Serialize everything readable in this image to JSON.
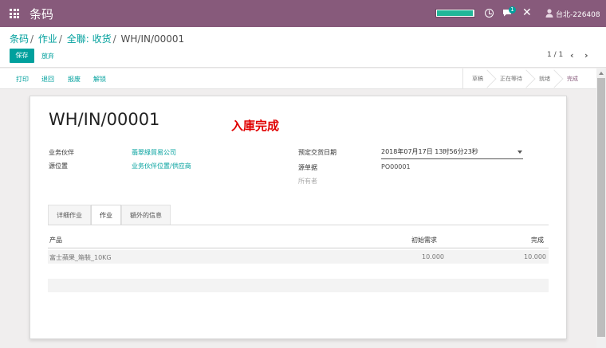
{
  "navbar": {
    "app_title": "条码",
    "user_name": "台北-226408",
    "badge_count": "1",
    "progress_percent": 98
  },
  "breadcrumb": {
    "items": [
      "条码",
      "作业",
      "全聯: 收货"
    ],
    "current": "WH/IN/00001"
  },
  "buttons": {
    "save": "保存",
    "discard": "放弃"
  },
  "pager": {
    "value": "1 / 1"
  },
  "actions": [
    "打印",
    "退回",
    "报废",
    "解锁"
  ],
  "stages": [
    {
      "label": "草稿",
      "active": false
    },
    {
      "label": "正在等待",
      "active": false
    },
    {
      "label": "就绪",
      "active": false
    },
    {
      "label": "完成",
      "active": true
    }
  ],
  "record": {
    "title": "WH/IN/00001",
    "stamp": "入庫完成",
    "partner_label": "业务伙伴",
    "partner_value": "翡翠綠貿易公司",
    "source_location_label": "源位置",
    "source_location_value": "业务伙伴位置/供应商",
    "scheduled_date_label": "预定交货日期",
    "scheduled_date_value": "2018年07月17日 13时56分23秒",
    "source_doc_label": "源单据",
    "source_doc_value": "PO00001",
    "owner_label": "所有者"
  },
  "tabs": [
    {
      "label": "详细作业",
      "active": false
    },
    {
      "label": "作业",
      "active": true
    },
    {
      "label": "額外的信息",
      "active": false
    }
  ],
  "table": {
    "headers": {
      "product": "产品",
      "initial_demand": "初始需求",
      "done": "完成"
    },
    "rows": [
      {
        "product": "富士蘋果_箱裝_10KG",
        "initial_demand": "10.000",
        "done": "10.000"
      }
    ]
  },
  "colors": {
    "brand": "#875a7b",
    "accent": "#00a09d",
    "stamp": "#e00000"
  },
  "icons": [
    "apps-grid-icon",
    "clock-icon",
    "chat-icon",
    "close-icon",
    "user-icon",
    "chevron-left-icon",
    "chevron-right-icon",
    "caret-down-icon"
  ]
}
